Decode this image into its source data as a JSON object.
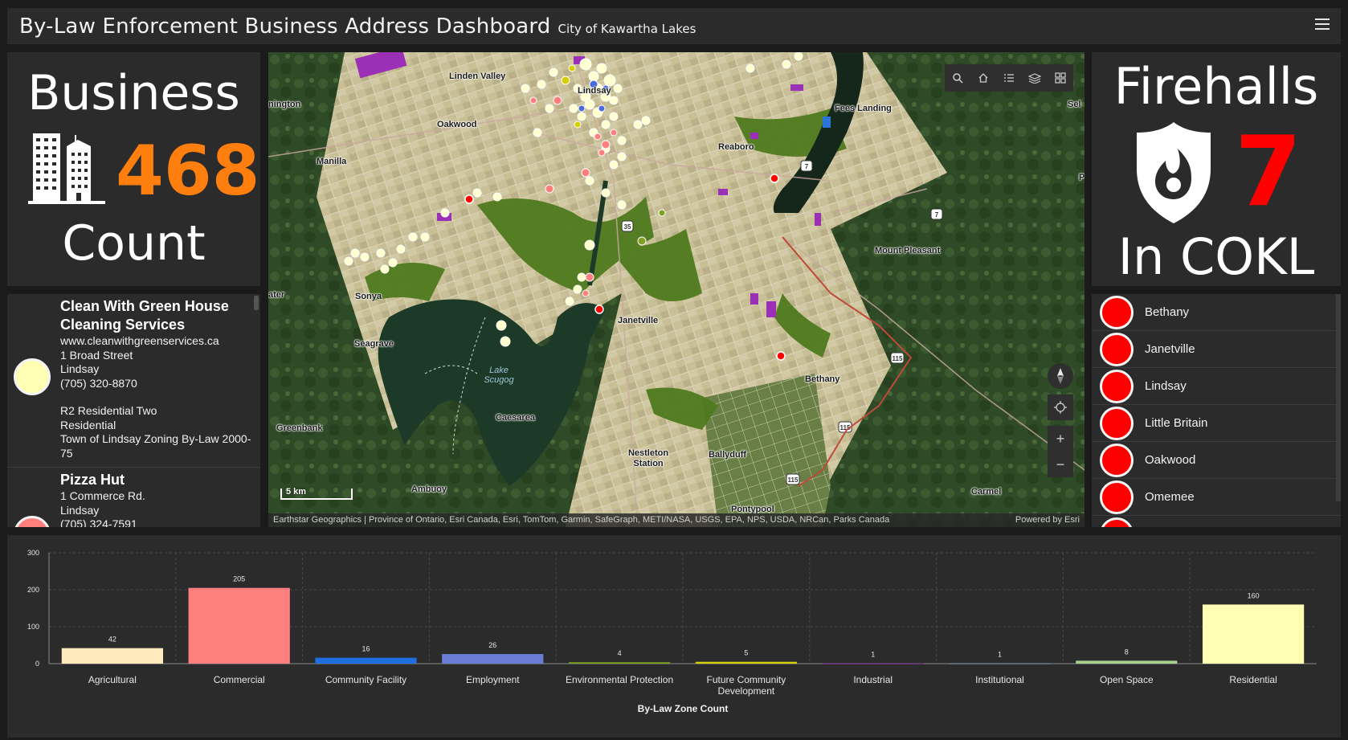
{
  "header": {
    "title": "By-Law Enforcement Business Address Dashboard",
    "subtitle": "City of Kawartha Lakes",
    "menu_icon": "hamburger-menu-icon"
  },
  "business_indicator": {
    "top_text": "Business",
    "value": "468",
    "bottom_text": "Count",
    "icon": "office-buildings-icon",
    "value_color": "#ff7f0e"
  },
  "firehall_indicator": {
    "top_text": "Firehalls",
    "value": "7",
    "bottom_text": "In COKL",
    "icon": "fire-shield-icon",
    "value_color": "#ff0000"
  },
  "business_list": [
    {
      "name": "Clean With Green House Cleaning Services",
      "lines": [
        "www.cleanwithgreenservices.ca",
        "1 Broad Street",
        "Lindsay",
        "(705) 320-8870"
      ],
      "zone_lines": [
        "R2 Residential Two",
        "Residential",
        "Town of Lindsay Zoning By-Law 2000-75"
      ],
      "dot_color": "#ffffb3"
    },
    {
      "name": "Pizza Hut",
      "lines": [
        "1 Commerce Rd.",
        "Lindsay",
        "(705) 324-7591"
      ],
      "zone_lines": [],
      "dot_color": "#ff7f7f"
    }
  ],
  "firehall_list": [
    "Bethany",
    "Janetville",
    "Lindsay",
    "Little Britain",
    "Oakwood",
    "Omemee",
    ""
  ],
  "map": {
    "tools": [
      "search-icon",
      "home-icon",
      "legend-icon",
      "layers-icon",
      "basemap-gallery-icon"
    ],
    "controls": [
      "compass-icon",
      "locate-icon",
      "zoom-in-icon",
      "zoom-out-icon"
    ],
    "place_labels": [
      "Linden Valley",
      "Lindsay",
      "Oakwood",
      "Reaboro",
      "Manilla",
      "Fees Landing",
      "Mount Pleasant",
      "Sonya",
      "Janetville",
      "Seagrave",
      "Bethany",
      "Caesarea",
      "Greenbank",
      "Nestleton Station",
      "Ballyduff",
      "Ambuoy",
      "Pontypool",
      "Carmel",
      "nington",
      "ater",
      "Sel",
      "P"
    ],
    "water_label": "Lake Scugog",
    "road_shields": [
      "7",
      "7",
      "35",
      "115",
      "115",
      "115"
    ],
    "scale_label": "5 km",
    "attribution": "Earthstar Geographics | Province of Ontario, Esri Canada, Esri, TomTom, Garmin, SafeGraph, METI/NASA, USGS, EPA, NPS, USDA, NRCan, Parks Canada",
    "powered_by": "Powered by Esri"
  },
  "chart_data": {
    "type": "bar",
    "categories": [
      "Agricultural",
      "Commercial",
      "Community Facility",
      "Employment",
      "Environmental Protection",
      "Future Community Development",
      "Industrial",
      "Institutional",
      "Open Space",
      "Residential"
    ],
    "values": [
      42,
      205,
      16,
      26,
      4,
      5,
      1,
      1,
      8,
      160
    ],
    "colors": [
      "#ffebbe",
      "#ff7f7f",
      "#1f6fe0",
      "#6b7ed6",
      "#7fa020",
      "#d4d000",
      "#9a3fae",
      "#8aa0b8",
      "#a8d08d",
      "#ffffb3"
    ],
    "xlabel": "By-Law Zone Count",
    "ylabel": "",
    "yticks": [
      0,
      100,
      200,
      300
    ],
    "ylim": [
      0,
      300
    ],
    "grid": true
  }
}
